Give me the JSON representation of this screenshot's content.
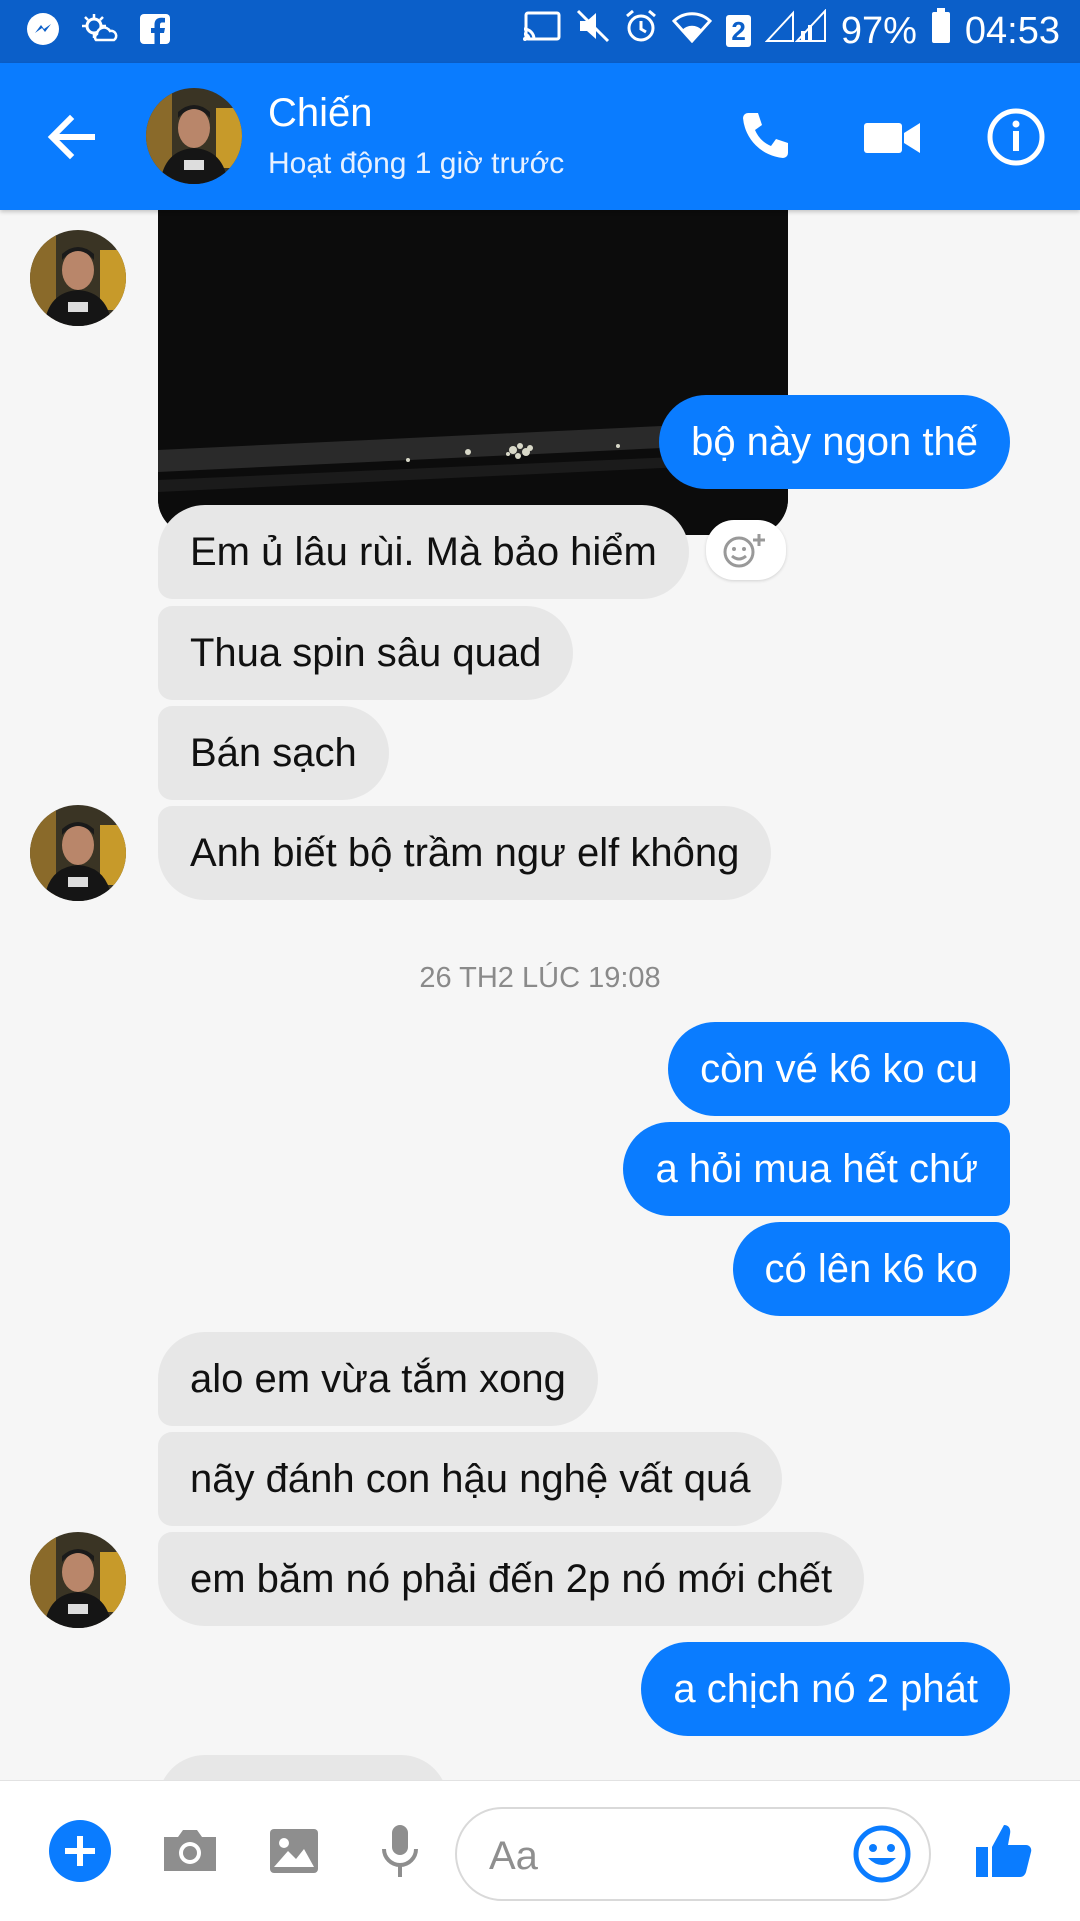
{
  "status_bar": {
    "battery": "97%",
    "time": "04:53",
    "sim_badge": "2"
  },
  "header": {
    "name": "Chiến",
    "status": "Hoạt động 1 giờ trước"
  },
  "messages": [
    {
      "side": "out",
      "text": "bộ này ngon thế"
    },
    {
      "side": "in",
      "text": "Em ủ lâu rùi. Mà bảo hiểm"
    },
    {
      "side": "in",
      "text": "Thua spin sâu quad"
    },
    {
      "side": "in",
      "text": "Bán sạch"
    },
    {
      "side": "in",
      "text": "Anh biết bộ trầm ngư elf không"
    },
    {
      "side": "out",
      "text": "còn vé k6 ko cu"
    },
    {
      "side": "out",
      "text": "a hỏi mua hết chứ"
    },
    {
      "side": "out",
      "text": "có lên k6 ko"
    },
    {
      "side": "in",
      "text": "alo em vừa tắm xong"
    },
    {
      "side": "in",
      "text": "nãy đánh con hậu nghệ vất quá"
    },
    {
      "side": "in",
      "text": "em băm nó phải đến 2p nó mới chết"
    },
    {
      "side": "out",
      "text": "a chịch nó 2 phát"
    }
  ],
  "timestamp": "26 TH2 LÚC 19:08",
  "composer": {
    "placeholder": "Aa"
  },
  "colors": {
    "accent": "#0a7cff",
    "status_bar": "#0b5fc9",
    "incoming_bubble": "#e7e7e7"
  }
}
